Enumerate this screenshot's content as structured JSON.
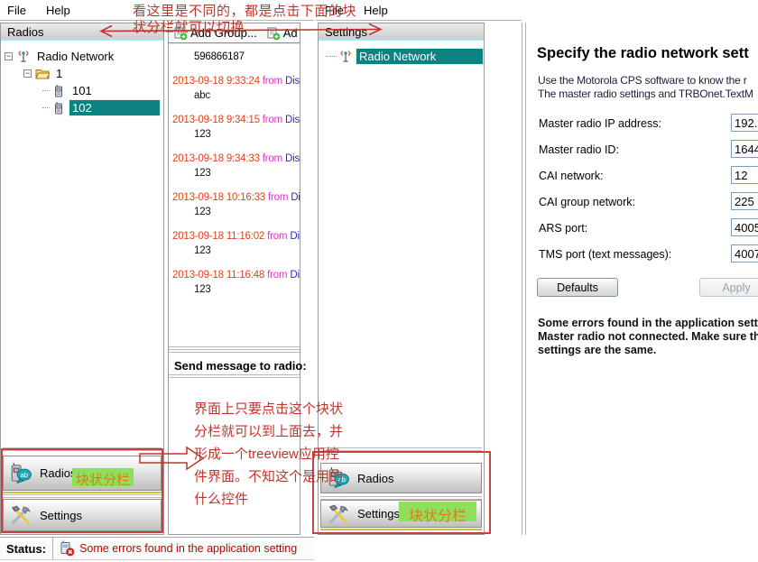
{
  "colors": {
    "selection_teal": "#0d8282",
    "header_underline_cyan": "#a9e7ef",
    "annotation_red": "#c0342c",
    "highlight_green": "#8ee05c",
    "highlight_text_orange": "#df7b16",
    "message_date_red": "#dd4422",
    "message_from_magenta": "#e132c8",
    "message_sender_blue": "#2e2ec0",
    "status_error_red": "#c00000"
  },
  "icons": [
    "network-antenna-icon",
    "folder-icon",
    "radio-icon",
    "add-group-icon",
    "add-radio-icon",
    "radios-speech-icon",
    "settings-tools-icon",
    "status-error-icon"
  ],
  "window1": {
    "menu": {
      "file": "File",
      "help": "Help"
    },
    "radios_panel": {
      "header": "Radios",
      "tree": {
        "root": "Radio Network",
        "group": "1",
        "radios": [
          "101",
          "102"
        ],
        "selected": "102"
      }
    },
    "messages_panel": {
      "toolbar": {
        "add_group": "Add Group...",
        "add_radio_partial": "Ad"
      },
      "group_id": "596866187",
      "messages": [
        {
          "datetime": "2013-09-18 9:33:24",
          "from_word": "from",
          "sender": "Disp",
          "text": "abc"
        },
        {
          "datetime": "2013-09-18 9:34:15",
          "from_word": "from",
          "sender": "Disp",
          "text": "123"
        },
        {
          "datetime": "2013-09-18 9:34:33",
          "from_word": "from",
          "sender": "Disp",
          "text": "123"
        },
        {
          "datetime": "2013-09-18 10:16:33",
          "from_word": "from",
          "sender": "Dis",
          "text": "123"
        },
        {
          "datetime": "2013-09-18 11:16:02",
          "from_word": "from",
          "sender": "Dis",
          "text": "123"
        },
        {
          "datetime": "2013-09-18 11:16:48",
          "from_word": "from",
          "sender": "Dis",
          "text": "123"
        }
      ],
      "send_label": "Send message to radio:"
    },
    "nav": {
      "radios": "Radios",
      "settings": "Settings"
    },
    "status": {
      "label": "Status:",
      "message": "Some errors found in the application setting"
    }
  },
  "window2": {
    "menu": {
      "file": "File",
      "help": "Help"
    },
    "settings_panel": {
      "header": "Settings",
      "tree_selected": "Radio Network"
    },
    "nav": {
      "radios": "Radios",
      "settings": "Settings"
    },
    "content": {
      "title": "Specify the radio network sett",
      "intro_line1": "Use the Motorola CPS software to know the r",
      "intro_line2": "The master radio settings and TRBOnet.TextM",
      "fields": [
        {
          "label": "Master radio IP address:",
          "value": "192."
        },
        {
          "label": "Master radio ID:",
          "value": "1644"
        },
        {
          "label": "CAI network:",
          "value": "12"
        },
        {
          "label": "CAI group network:",
          "value": "225"
        },
        {
          "label": "ARS port:",
          "value": "4005"
        },
        {
          "label": "TMS port (text messages):",
          "value": "4007"
        }
      ],
      "defaults_button": "Defaults",
      "apply_button": "Apply",
      "warning_line1": "Some errors found in the application setting",
      "warning_line2": "Master radio not connected. Make sure that",
      "warning_line3": "settings are the same."
    }
  },
  "annotations": {
    "top_note_line1": "看这里是不同的，都是点击下面的块",
    "top_note_line2": "状分栏就可以切换",
    "block_label": "块状分栏",
    "mid_note": "界面上只要点击这个块状\n分栏就可以到上面去，并\n形成一个treeview应用控\n件界面。不知这个是用的\n什么控件"
  }
}
